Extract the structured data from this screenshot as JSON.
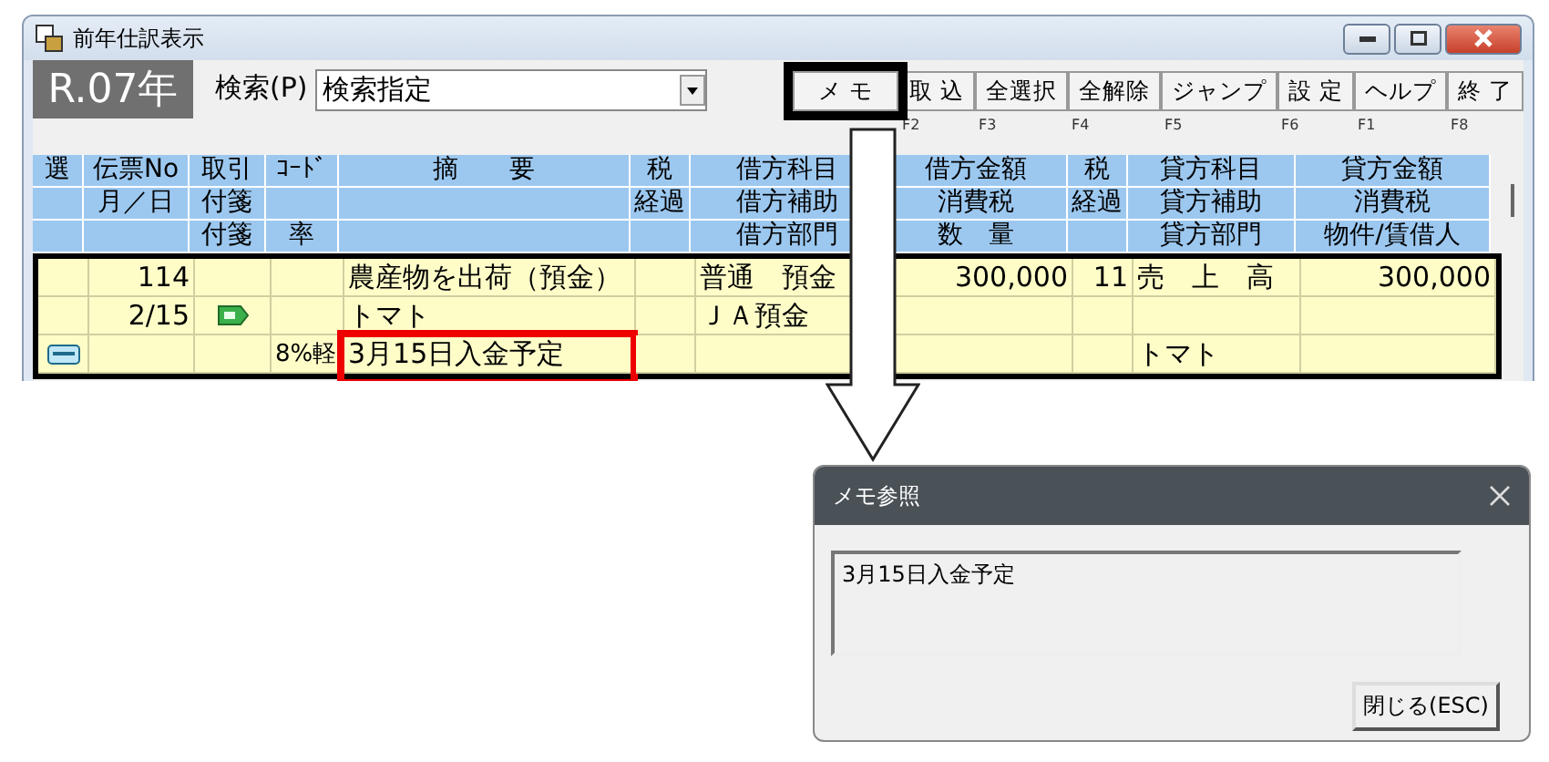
{
  "window": {
    "title": "前年仕訳表示"
  },
  "year_badge": "R.07年",
  "search": {
    "label": "検索(P)",
    "value": "検索指定"
  },
  "toolbar": [
    {
      "label": "メ モ",
      "annotated": true
    },
    {
      "label": "取 込",
      "key": "F2",
      "annotated": false
    },
    {
      "label": "全選択",
      "key": "F3",
      "annotated": false
    },
    {
      "label": "全解除",
      "key": "F4",
      "annotated": false
    },
    {
      "label": "ジャンプ",
      "key": "F5",
      "annotated": false
    },
    {
      "label": "設 定",
      "key": "F6",
      "annotated": false
    },
    {
      "label": "ヘルプ",
      "key": "F1",
      "annotated": false
    },
    {
      "label": "終 了",
      "key": "F8",
      "annotated": false
    }
  ],
  "table": {
    "header_rows": [
      [
        "選",
        "伝票No",
        "取引",
        "ｺｰﾄﾞ",
        "摘　　要",
        "税",
        "借方科目",
        "借方金額",
        "税",
        "貸方科目",
        "貸方金額"
      ],
      [
        null,
        "月／日",
        "付箋",
        null,
        null,
        "経過",
        "借方補助",
        "消費税",
        "経過",
        "貸方補助",
        "消費税"
      ],
      [
        null,
        null,
        "付箋",
        "率",
        null,
        null,
        "借方部門",
        "数　量",
        null,
        "貸方部門",
        "物件/賃借人"
      ]
    ],
    "rows": [
      [
        null,
        "114",
        null,
        null,
        "農産物を出荷（預金）",
        null,
        "普通　預金",
        "300,000",
        "11",
        "売　上　高",
        "300,000"
      ],
      [
        null,
        "2/15",
        {
          "kind": "memo-tag"
        },
        null,
        "トマト",
        null,
        "ＪＡ預金",
        null,
        null,
        null,
        null
      ],
      [
        {
          "kind": "memo-card"
        },
        null,
        null,
        "8%軽",
        {
          "text": "3月15日入金予定",
          "annotated": true
        },
        null,
        null,
        null,
        null,
        "トマト",
        null
      ]
    ]
  },
  "dialog": {
    "title": "メモ参照",
    "memo": "3月15日入金予定",
    "close_button": "閉じる(ESC)"
  }
}
